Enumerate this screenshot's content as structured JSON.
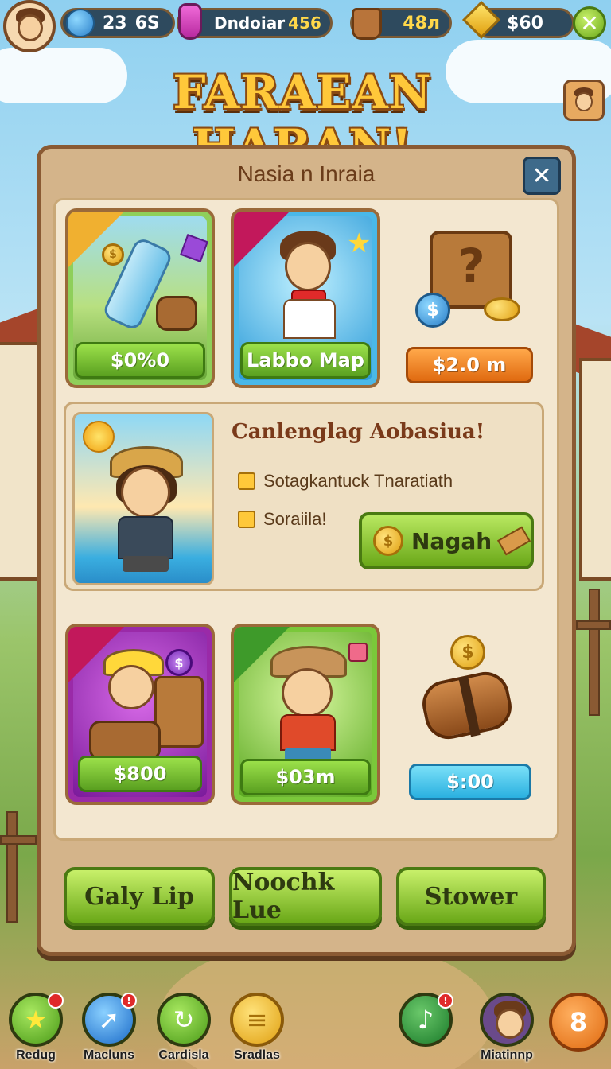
{
  "topbar": {
    "stat_a": "23",
    "stat_b": "6S",
    "player_name": "Dndoiar",
    "player_level": "456",
    "wood_count": "48л",
    "gem_count": "$60",
    "plus_icon": "✕"
  },
  "title": "FARAEAN HARAN!",
  "panel": {
    "title": "Nasia n Inraia",
    "close_icon": "✕"
  },
  "cards": [
    {
      "price": "$0%0",
      "ribbon_color": "#f0b030",
      "art": "water-bottle-and-barrel"
    },
    {
      "price": "Labbo Map",
      "ribbon_color": "#c2185b",
      "art": "boy-character"
    },
    {
      "price": "$2.0 m",
      "art": "treasure-chest"
    },
    {
      "price": "$800",
      "ribbon_color": "#c2185b",
      "art": "kid-with-treasure"
    },
    {
      "price": "$03m",
      "ribbon_color": "#3e9a2a",
      "art": "explorer-boy"
    },
    {
      "price": "$:00",
      "art": "log-with-coin"
    }
  ],
  "feature": {
    "title": "Canlenglag Aobasiua!",
    "items": [
      "Sotagkantuck Tnaratiath",
      "Soraiila!"
    ],
    "button_label": "Nagah"
  },
  "actions": [
    "Galy Lip",
    "Noochk Lue",
    "Stower"
  ],
  "nav": [
    {
      "label": "Redug",
      "icon": "star-icon",
      "badge": true,
      "color": "#5ab82a"
    },
    {
      "label": "Macluns",
      "icon": "arrow-icon",
      "badge": true,
      "color": "#2a8ae0"
    },
    {
      "label": "Cardisla",
      "icon": "refresh-icon",
      "badge": false,
      "color": "#5ab82a"
    },
    {
      "label": "Sradlas",
      "icon": "coin-stack-icon",
      "badge": false,
      "color": "#f0b020"
    },
    {
      "label": "",
      "icon": "music-icon",
      "badge": true,
      "color": "#3a9a3a"
    },
    {
      "label": "Miatinnp",
      "icon": "avatar-icon",
      "badge": false,
      "color": "#6a4a8a"
    },
    {
      "label": "",
      "icon": "monkey-icon",
      "badge": false,
      "color": "#f08a20"
    }
  ],
  "colors": {
    "accent": "#6aa818",
    "panel": "#d4b48a",
    "title": "#ffc83a"
  }
}
